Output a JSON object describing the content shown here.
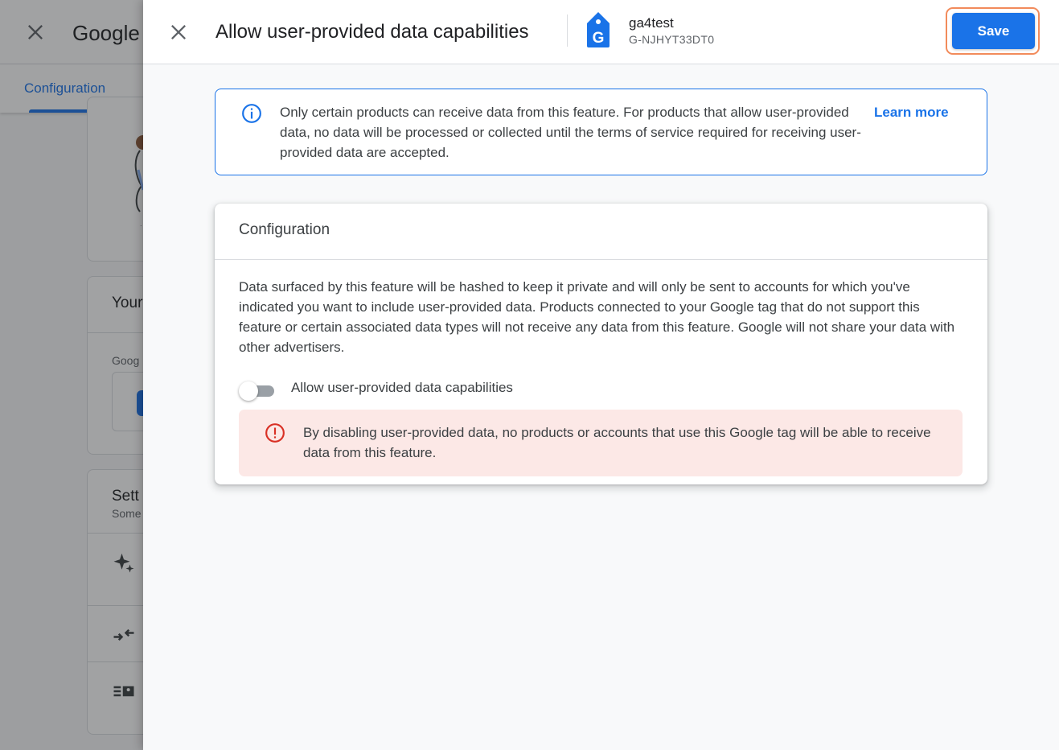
{
  "background": {
    "app_title": "Google",
    "tabs": [
      {
        "label": "Configuration"
      }
    ],
    "cards": [
      {
        "title": "Your",
        "subtitle": "Goog"
      },
      {
        "title": "Sett",
        "subtitle": "Some"
      }
    ]
  },
  "panel": {
    "title": "Allow user-provided data capabilities",
    "tag": {
      "name": "ga4test",
      "id": "G-NJHYT33DT0",
      "icon_letter": "G"
    },
    "save_label": "Save",
    "info_banner": {
      "text": "Only certain products can receive data from this feature. For products that allow user-provided data, no data will be processed or collected until the terms of service required for receiving user-provided data are accepted.",
      "link_label": "Learn more"
    },
    "config_card": {
      "title": "Configuration",
      "description": "Data surfaced by this feature will be hashed to keep it private and will only be sent to accounts for which you've indicated you want to include user-provided data. Products connected to your Google tag that do not support this feature or certain associated data types will not receive any data from this feature. Google will not share your data with other advertisers.",
      "toggle": {
        "label": "Allow user-provided data capabilities",
        "enabled": false
      },
      "warning_text": "By disabling user-provided data, no products or accounts that use this Google tag will be able to receive data from this feature."
    }
  },
  "colors": {
    "accent": "#1a73e8",
    "error": "#d93025",
    "error_bg": "#fce8e6",
    "highlight": "#f28b5b"
  },
  "icons": [
    "close-icon",
    "tag-icon",
    "info-icon",
    "error-icon",
    "sparkle-icon",
    "merge-icon",
    "list-icon"
  ]
}
